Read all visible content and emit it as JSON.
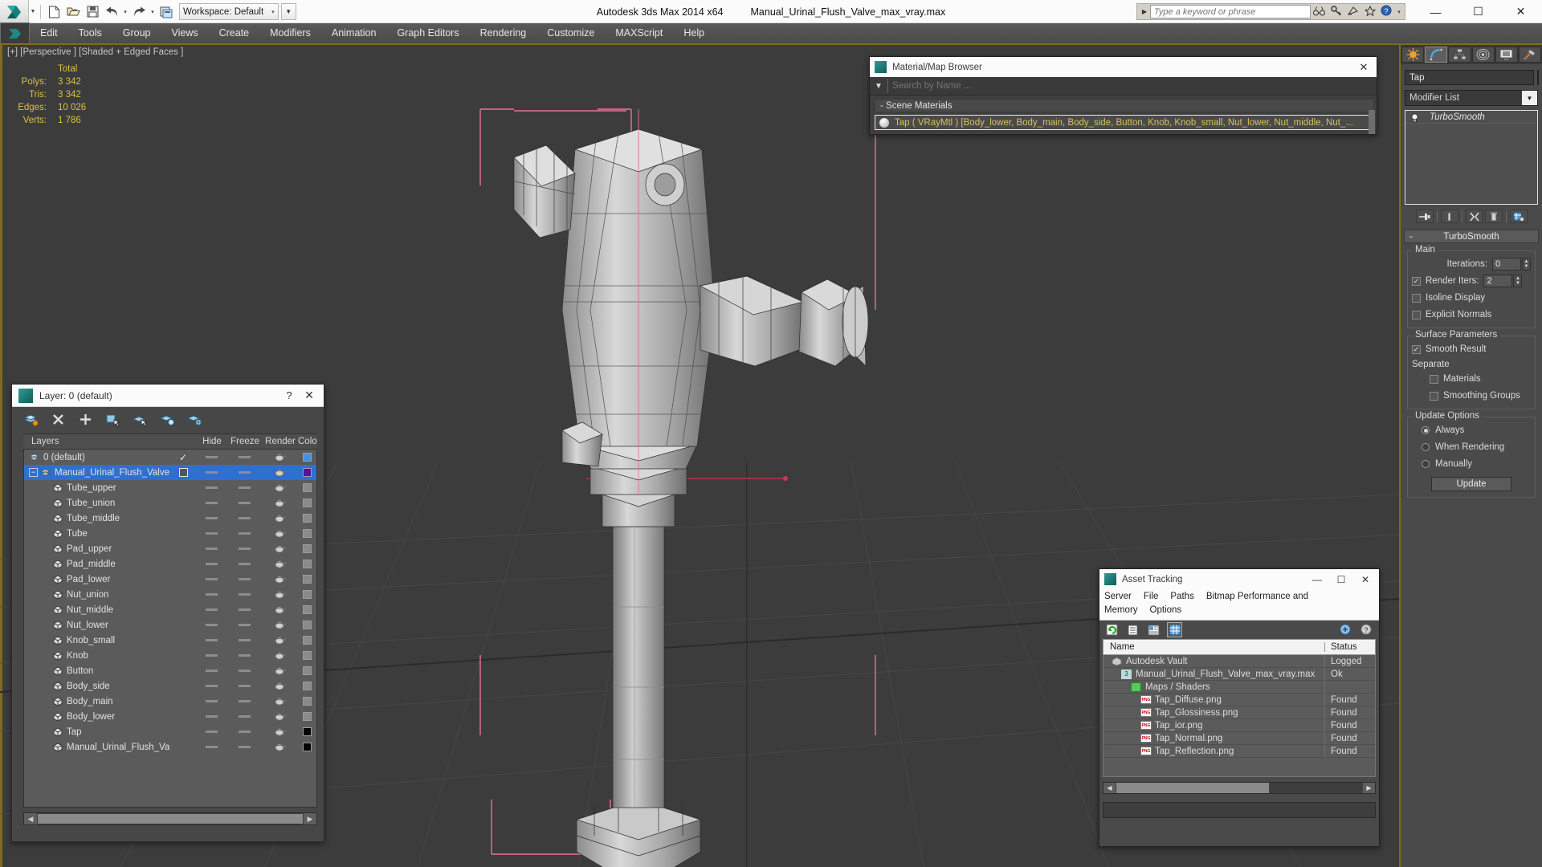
{
  "titlebar": {
    "app_title": "Autodesk 3ds Max  2014 x64",
    "file_title": "Manual_Urinal_Flush_Valve_max_vray.max",
    "workspace": "Workspace: Default",
    "search_placeholder": "Type a keyword or phrase",
    "minimize": "—",
    "maximize": "☐",
    "close": "✕"
  },
  "menubar": {
    "items": [
      "Edit",
      "Tools",
      "Group",
      "Views",
      "Create",
      "Modifiers",
      "Animation",
      "Graph Editors",
      "Rendering",
      "Customize",
      "MAXScript",
      "Help"
    ]
  },
  "viewport": {
    "label": "[+] [Perspective ] [Shaded + Edged Faces ]",
    "stats": {
      "header": "Total",
      "rows": [
        {
          "label": "Polys:",
          "value": "3 342"
        },
        {
          "label": "Tris:",
          "value": "3 342"
        },
        {
          "label": "Edges:",
          "value": "10 026"
        },
        {
          "label": "Verts:",
          "value": "1 786"
        }
      ]
    }
  },
  "layer_dialog": {
    "title": "Layer: 0 (default)",
    "help_label": "?",
    "close_label": "✕",
    "columns": [
      "Layers",
      "Hide",
      "Freeze",
      "Render",
      "Colo"
    ],
    "rows": [
      {
        "name": "0 (default)",
        "indent": 0,
        "type": "layer",
        "check": "✓",
        "color": "#4a90e2",
        "selected": false,
        "expander": ""
      },
      {
        "name": "Manual_Urinal_Flush_Valve",
        "indent": 0,
        "type": "layer",
        "check": "box",
        "color": "#5c0fa0",
        "selected": true,
        "expander": "−"
      },
      {
        "name": "Tube_upper",
        "indent": 1,
        "type": "object",
        "check": "",
        "color": "#8a8a8a",
        "selected": false,
        "expander": ""
      },
      {
        "name": "Tube_union",
        "indent": 1,
        "type": "object",
        "check": "",
        "color": "#8a8a8a",
        "selected": false,
        "expander": ""
      },
      {
        "name": "Tube_middle",
        "indent": 1,
        "type": "object",
        "check": "",
        "color": "#8a8a8a",
        "selected": false,
        "expander": ""
      },
      {
        "name": "Tube",
        "indent": 1,
        "type": "object",
        "check": "",
        "color": "#8a8a8a",
        "selected": false,
        "expander": ""
      },
      {
        "name": "Pad_upper",
        "indent": 1,
        "type": "object",
        "check": "",
        "color": "#8a8a8a",
        "selected": false,
        "expander": ""
      },
      {
        "name": "Pad_middle",
        "indent": 1,
        "type": "object",
        "check": "",
        "color": "#8a8a8a",
        "selected": false,
        "expander": ""
      },
      {
        "name": "Pad_lower",
        "indent": 1,
        "type": "object",
        "check": "",
        "color": "#8a8a8a",
        "selected": false,
        "expander": ""
      },
      {
        "name": "Nut_union",
        "indent": 1,
        "type": "object",
        "check": "",
        "color": "#8a8a8a",
        "selected": false,
        "expander": ""
      },
      {
        "name": "Nut_middle",
        "indent": 1,
        "type": "object",
        "check": "",
        "color": "#8a8a8a",
        "selected": false,
        "expander": ""
      },
      {
        "name": "Nut_lower",
        "indent": 1,
        "type": "object",
        "check": "",
        "color": "#8a8a8a",
        "selected": false,
        "expander": ""
      },
      {
        "name": "Knob_small",
        "indent": 1,
        "type": "object",
        "check": "",
        "color": "#8a8a8a",
        "selected": false,
        "expander": ""
      },
      {
        "name": "Knob",
        "indent": 1,
        "type": "object",
        "check": "",
        "color": "#8a8a8a",
        "selected": false,
        "expander": ""
      },
      {
        "name": "Button",
        "indent": 1,
        "type": "object",
        "check": "",
        "color": "#8a8a8a",
        "selected": false,
        "expander": ""
      },
      {
        "name": "Body_side",
        "indent": 1,
        "type": "object",
        "check": "",
        "color": "#8a8a8a",
        "selected": false,
        "expander": ""
      },
      {
        "name": "Body_main",
        "indent": 1,
        "type": "object",
        "check": "",
        "color": "#8a8a8a",
        "selected": false,
        "expander": ""
      },
      {
        "name": "Body_lower",
        "indent": 1,
        "type": "object",
        "check": "",
        "color": "#8a8a8a",
        "selected": false,
        "expander": ""
      },
      {
        "name": "Tap",
        "indent": 1,
        "type": "object",
        "check": "",
        "color": "#000000",
        "selected": false,
        "expander": ""
      },
      {
        "name": "Manual_Urinal_Flush_Valve",
        "indent": 1,
        "type": "object",
        "check": "",
        "color": "#000000",
        "selected": false,
        "expander": ""
      }
    ]
  },
  "material_browser": {
    "title": "Material/Map Browser",
    "close_label": "✕",
    "search_placeholder": "Search by Name ...",
    "group_label": "- Scene Materials",
    "item_label": "Tap  ( VRayMtl )  [Body_lower, Body_main, Body_side, Button, Knob, Knob_small, Nut_lower, Nut_middle, Nut_...",
    "item_color": "#d8c060"
  },
  "asset_tracking": {
    "title": "Asset Tracking",
    "minimize": "—",
    "maximize": "☐",
    "close": "✕",
    "menu": [
      "Server",
      "File",
      "Paths",
      "Bitmap Performance and Memory",
      "Options"
    ],
    "columns": {
      "name": "Name",
      "status": "Status"
    },
    "rows": [
      {
        "name": "Autodesk Vault",
        "status": "Logged",
        "icon": "vault-icon",
        "indent": 0
      },
      {
        "name": "Manual_Urinal_Flush_Valve_max_vray.max",
        "status": "Ok",
        "icon": "max-file-icon",
        "indent": 1
      },
      {
        "name": "Maps / Shaders",
        "status": "",
        "icon": "maps-icon",
        "indent": 2
      },
      {
        "name": "Tap_Diffuse.png",
        "status": "Found",
        "icon": "png-icon",
        "indent": 3
      },
      {
        "name": "Tap_Glossiness.png",
        "status": "Found",
        "icon": "png-icon",
        "indent": 3
      },
      {
        "name": "Tap_ior.png",
        "status": "Found",
        "icon": "png-icon",
        "indent": 3
      },
      {
        "name": "Tap_Normal.png",
        "status": "Found",
        "icon": "png-icon",
        "indent": 3
      },
      {
        "name": "Tap_Reflection.png",
        "status": "Found",
        "icon": "png-icon",
        "indent": 3
      }
    ],
    "scroll_left": "◀",
    "scroll_right": "▶"
  },
  "command_panel": {
    "tabs": [
      "create-tab",
      "modify-tab",
      "hierarchy-tab",
      "motion-tab",
      "display-tab",
      "utilities-tab"
    ],
    "object_name": "Tap",
    "modifier_list_label": "Modifier List",
    "stack": [
      {
        "label": "TurboSmooth"
      }
    ],
    "rollup": {
      "title": "TurboSmooth",
      "collapse_icon": "-",
      "groups": [
        {
          "title": "Main",
          "fields": [
            {
              "type": "spinner",
              "label": "Iterations:",
              "value": "0"
            },
            {
              "type": "checkbox-spinner",
              "label": "Render Iters:",
              "value": "2",
              "checked": true
            },
            {
              "type": "checkbox",
              "label": "Isoline Display",
              "checked": false
            },
            {
              "type": "checkbox",
              "label": "Explicit Normals",
              "checked": false
            }
          ]
        },
        {
          "title": "Surface Parameters",
          "fields": [
            {
              "type": "checkbox",
              "label": "Smooth Result",
              "checked": true
            },
            {
              "type": "text",
              "label": "Separate"
            },
            {
              "type": "checkbox-indent",
              "label": "Materials",
              "checked": false
            },
            {
              "type": "checkbox-indent",
              "label": "Smoothing Groups",
              "checked": false
            }
          ]
        },
        {
          "title": "Update Options",
          "fields": [
            {
              "type": "radio",
              "label": "Always",
              "checked": true
            },
            {
              "type": "radio",
              "label": "When Rendering",
              "checked": false
            },
            {
              "type": "radio",
              "label": "Manually",
              "checked": false
            },
            {
              "type": "button",
              "label": "Update"
            }
          ]
        }
      ]
    }
  }
}
